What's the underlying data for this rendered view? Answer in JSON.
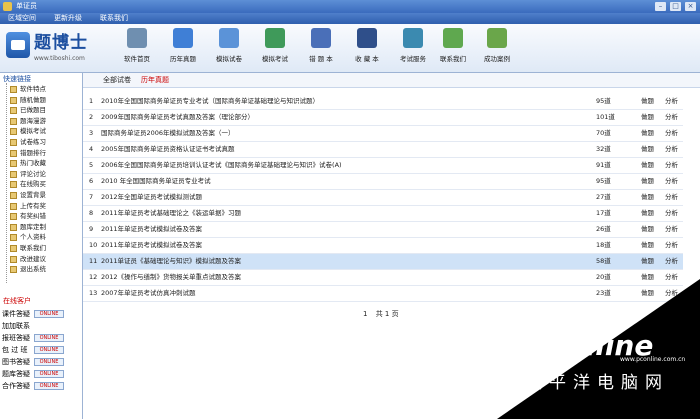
{
  "window": {
    "title": "单证员"
  },
  "menubar": {
    "items": [
      "区域空间",
      "更新升级",
      "联系我们"
    ]
  },
  "logo": {
    "brand": "题博士",
    "url": "www.tiboshi.com"
  },
  "toolbar": {
    "buttons": [
      {
        "label": "软件首页",
        "icon": "home-icon",
        "color": "#6f8fb0"
      },
      {
        "label": "历年真题",
        "icon": "exam-papers-icon",
        "color": "#3f7fd6"
      },
      {
        "label": "模拟试卷",
        "icon": "mock-paper-icon",
        "color": "#5b93d8"
      },
      {
        "label": "模拟考试",
        "icon": "student-icon",
        "color": "#3f9a5a"
      },
      {
        "label": "错 题 本",
        "icon": "wrong-book-icon",
        "color": "#4a6fb8"
      },
      {
        "label": "收 藏 本",
        "icon": "favorites-book-icon",
        "color": "#2f4f8a"
      },
      {
        "label": "考试服务",
        "icon": "service-icon",
        "color": "#3b8ab0"
      },
      {
        "label": "联系我们",
        "icon": "contact-icon",
        "color": "#5fa84f"
      },
      {
        "label": "成功案例",
        "icon": "case-icon",
        "color": "#6aa64a"
      }
    ]
  },
  "sidebar": {
    "header": "快速链接",
    "items": [
      "软件特点",
      "随机做题",
      "已做题目",
      "题海漫游",
      "模拟考试",
      "试卷练习",
      "错题排行",
      "热门收藏",
      "评论讨论",
      "在线购买",
      "设置背景",
      "上传有奖",
      "有奖纠错",
      "题库定制",
      "个人资料",
      "联系我们",
      "改进建议",
      "退出系统"
    ],
    "service_title": "在线客户",
    "service_rows": [
      "课件答疑",
      "加加联系",
      "报班答疑",
      "包 过 班",
      "图书答疑",
      "题库答疑",
      "合作答疑"
    ],
    "online_badge": "ONLINE"
  },
  "tabs": {
    "items": [
      "全部试卷",
      "历年真题"
    ]
  },
  "exams": [
    {
      "num": "1",
      "name": "2010年全国国际商务单证员专业考试（国际商务单证基础理论与知识试题）",
      "count": "95道",
      "do": "做题",
      "analyze": "分析"
    },
    {
      "num": "2",
      "name": "2009年国际商务单证员考试真题及答案（理论部分）",
      "count": "101道",
      "do": "做题",
      "analyze": "分析"
    },
    {
      "num": "3",
      "name": "国际商务单证员2006年模拟试题及答案（一）",
      "count": "70道",
      "do": "做题",
      "analyze": "分析"
    },
    {
      "num": "4",
      "name": "2005年国际商务单证员资格认证证书考试真题",
      "count": "32道",
      "do": "做题",
      "analyze": "分析"
    },
    {
      "num": "5",
      "name": "2006年全国国际商务单证员培训认证考试《国际商务单证基础理论与知识》试卷(A)",
      "count": "91道",
      "do": "做题",
      "analyze": "分析"
    },
    {
      "num": "6",
      "name": "2010 年全国国际商务单证员专业考试",
      "count": "95道",
      "do": "做题",
      "analyze": "分析"
    },
    {
      "num": "7",
      "name": "2012年全国单证员考试模拟测试题",
      "count": "27道",
      "do": "做题",
      "analyze": "分析"
    },
    {
      "num": "8",
      "name": "2011年单证员考试基础理论之《装运单据》习题",
      "count": "17道",
      "do": "做题",
      "analyze": "分析"
    },
    {
      "num": "9",
      "name": "2011年单证员考试模拟试卷及答案",
      "count": "26道",
      "do": "做题",
      "analyze": "分析"
    },
    {
      "num": "10",
      "name": "2011年单证员考试模拟试卷及答案",
      "count": "18道",
      "do": "做题",
      "analyze": "分析"
    },
    {
      "num": "11",
      "name": "2011单证员《基础理论与知识》模拟试题及答案",
      "count": "58道",
      "do": "做题",
      "analyze": "分析"
    },
    {
      "num": "12",
      "name": "2012《操作与缮制》货物报关单重点试题及答案",
      "count": "20道",
      "do": "做题",
      "analyze": "分析"
    },
    {
      "num": "13",
      "name": "2007年单证员考试仿真冲刺试题",
      "count": "23道",
      "do": "做题",
      "analyze": "分析"
    }
  ],
  "pager": {
    "current": "1",
    "total_label": "共 1 页"
  },
  "watermark": {
    "brand": "PConline",
    "cn": "太平洋电脑网",
    "url": "www.pconline.com.cn"
  }
}
